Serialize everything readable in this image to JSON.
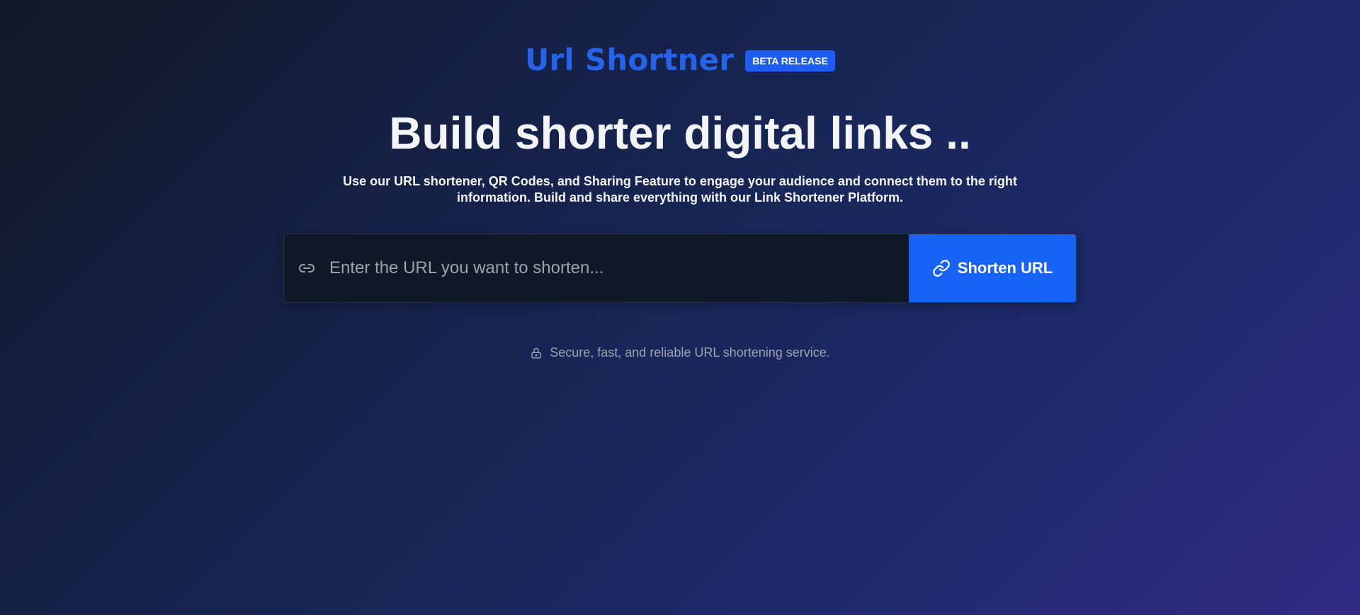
{
  "header": {
    "brand_title": "Url Shortner",
    "badge": "BETA RELEASE"
  },
  "hero": {
    "headline": "Build shorter digital links ..",
    "subtext_line1": "Use our URL shortener, QR Codes, and Sharing Feature to engage your audience and connect them to the right",
    "subtext_line2": "information. Build and share everything with our Link Shortener Platform."
  },
  "form": {
    "input_value": "",
    "input_placeholder": "Enter the URL you want to shorten...",
    "input_icon": "link-icon",
    "button_label": "Shorten URL",
    "button_icon": "chain-link-icon"
  },
  "footer": {
    "note": "Secure, fast, and reliable URL shortening service.",
    "note_icon": "lock-icon"
  },
  "colors": {
    "brand": "#2563eb",
    "badge_bg": "#1d5cf5",
    "button_bg": "#1762f7",
    "input_bg": "#111827",
    "muted_text": "#9ca3af"
  }
}
